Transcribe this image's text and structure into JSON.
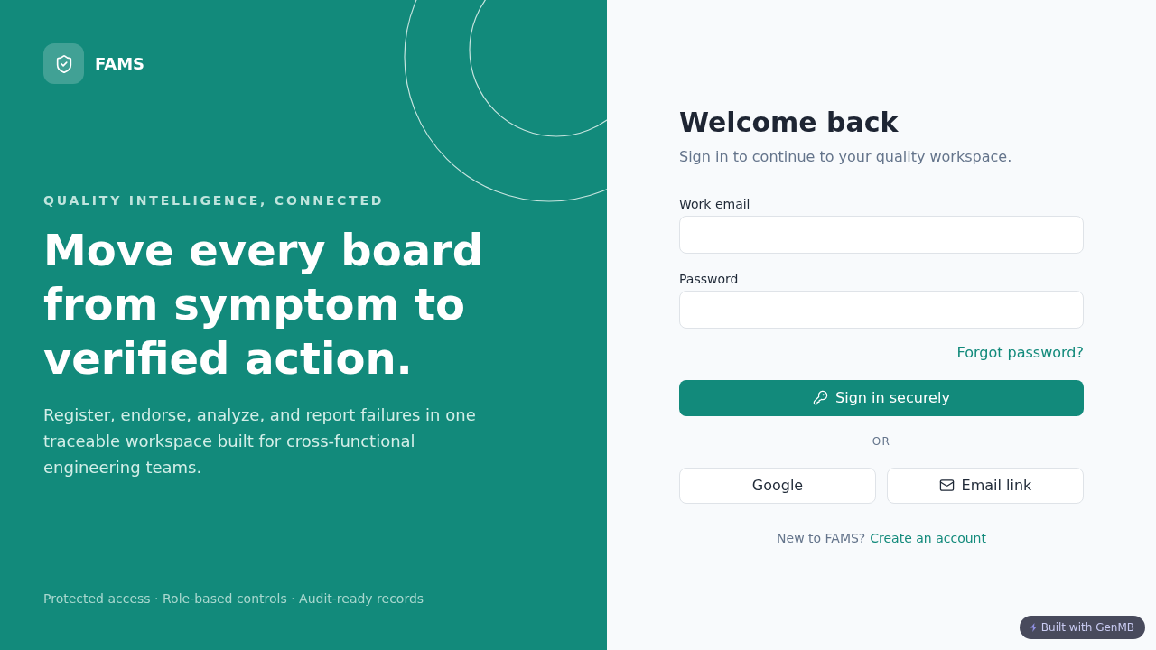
{
  "brand": {
    "name": "FAMS"
  },
  "hero": {
    "eyebrow": "QUALITY INTELLIGENCE, CONNECTED",
    "headline": "Move every board from symptom to verified action.",
    "description": "Register, endorse, analyze, and report failures in one traceable workspace built for cross-functional engineering teams."
  },
  "footer_note": "Protected access · Role-based controls · Audit-ready records",
  "sign_in": {
    "title": "Welcome back",
    "subtitle": "Sign in to continue to your quality workspace.",
    "fields": [
      {
        "label": "Work email"
      },
      {
        "label": "Password"
      }
    ],
    "forgot_link": "Forgot password?",
    "submit_button": "Sign in securely",
    "divider": "OR",
    "alt_buttons": [
      {
        "label": "Google",
        "kind": "plain"
      },
      {
        "label": "Email link",
        "kind": "email"
      }
    ],
    "signup_prompt": "New to FAMS?",
    "signup_link": "Create an account"
  },
  "badge": {
    "label": "Built with GenMB"
  }
}
